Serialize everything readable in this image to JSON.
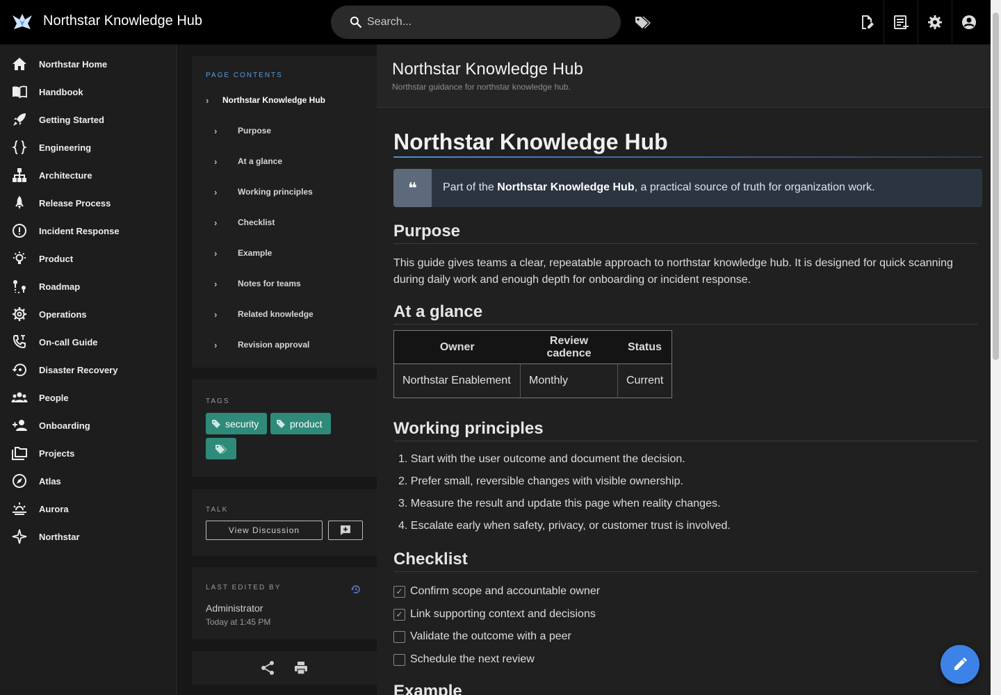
{
  "app": {
    "title": "Northstar Knowledge Hub"
  },
  "search": {
    "placeholder": "Search..."
  },
  "sidebar": {
    "items": [
      {
        "label": "Northstar Home",
        "icon": "home-icon"
      },
      {
        "label": "Handbook",
        "icon": "book-open-icon"
      },
      {
        "label": "Getting Started",
        "icon": "rocket-icon"
      },
      {
        "label": "Engineering",
        "icon": "code-braces-icon"
      },
      {
        "label": "Architecture",
        "icon": "sitemap-icon"
      },
      {
        "label": "Release Process",
        "icon": "rocket-launch-icon"
      },
      {
        "label": "Incident Response",
        "icon": "alert-circle-icon"
      },
      {
        "label": "Product",
        "icon": "lightbulb-icon"
      },
      {
        "label": "Roadmap",
        "icon": "map-marker-path-icon"
      },
      {
        "label": "Operations",
        "icon": "cog-icon"
      },
      {
        "label": "On-call Guide",
        "icon": "phone-icon"
      },
      {
        "label": "Disaster Recovery",
        "icon": "backup-restore-icon"
      },
      {
        "label": "People",
        "icon": "account-group-icon"
      },
      {
        "label": "Onboarding",
        "icon": "account-plus-icon"
      },
      {
        "label": "Projects",
        "icon": "folder-multiple-icon"
      },
      {
        "label": "Atlas",
        "icon": "compass-icon"
      },
      {
        "label": "Aurora",
        "icon": "weather-sunset-icon"
      },
      {
        "label": "Northstar",
        "icon": "star-four-points-icon"
      }
    ]
  },
  "toc": {
    "heading": "PAGE CONTENTS",
    "top": "Northstar Knowledge Hub",
    "items": [
      "Purpose",
      "At a glance",
      "Working principles",
      "Checklist",
      "Example",
      "Notes for teams",
      "Related knowledge",
      "Revision approval"
    ]
  },
  "tags": {
    "heading": "TAGS",
    "items": [
      "security",
      "product"
    ]
  },
  "talk": {
    "heading": "TALK",
    "view_label": "View Discussion"
  },
  "last_edited": {
    "heading": "LAST EDITED BY",
    "name": "Administrator",
    "time": "Today at 1:45 PM"
  },
  "page_header": {
    "title": "Northstar Knowledge Hub",
    "subtitle": "Northstar guidance for northstar knowledge hub."
  },
  "content": {
    "h1": "Northstar Knowledge Hub",
    "quote_pre": "Part of the ",
    "quote_bold": "Northstar Knowledge Hub",
    "quote_post": ", a practical source of truth for organization work.",
    "purpose_heading": "Purpose",
    "purpose_text": "This guide gives teams a clear, repeatable approach to northstar knowledge hub. It is designed for quick scanning during daily work and enough depth for onboarding or incident response.",
    "glance_heading": "At a glance",
    "table": {
      "headers": [
        "Owner",
        "Review cadence",
        "Status"
      ],
      "row": [
        "Northstar Enablement",
        "Monthly",
        "Current"
      ]
    },
    "principles_heading": "Working principles",
    "principles": [
      "1. Start with the user outcome and document the decision.",
      "2. Prefer small, reversible changes with visible ownership.",
      "3. Measure the result and update this page when reality changes.",
      "4. Escalate early when safety, privacy, or customer trust is involved."
    ],
    "checklist_heading": "Checklist",
    "checklist": [
      {
        "label": "Confirm scope and accountable owner",
        "checked": true
      },
      {
        "label": "Link supporting context and decisions",
        "checked": true
      },
      {
        "label": "Validate the outcome with a peer",
        "checked": false
      },
      {
        "label": "Schedule the next review",
        "checked": false
      }
    ],
    "example_heading": "Example"
  },
  "colors": {
    "accent": "#3d82e6",
    "tag": "#2e8b7a",
    "toc_heading": "#5c9ce6"
  }
}
